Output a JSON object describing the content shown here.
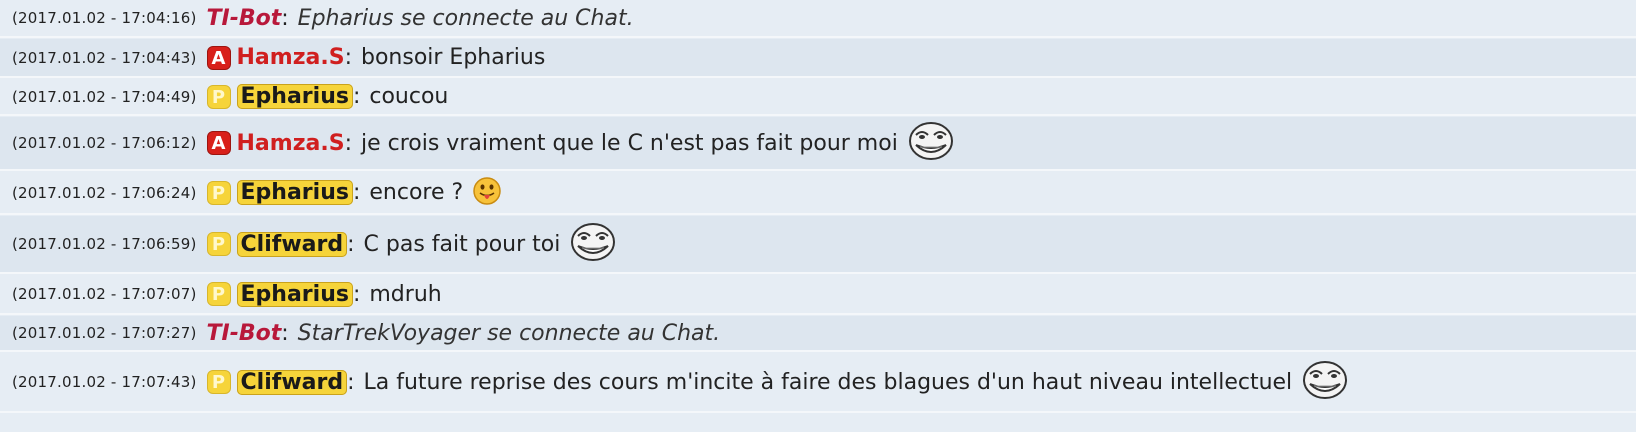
{
  "messages": [
    {
      "timestamp": "(2017.01.02 - 17:04:16)",
      "role": "",
      "user": "TI-Bot",
      "user_type": "bot",
      "text": "Epharius se connecte au Chat.",
      "emoticon": ""
    },
    {
      "timestamp": "(2017.01.02 - 17:04:43)",
      "role": "A",
      "user": "Hamza.S",
      "user_type": "admin",
      "text": "bonsoir Epharius",
      "emoticon": ""
    },
    {
      "timestamp": "(2017.01.02 - 17:04:49)",
      "role": "P",
      "user": "Epharius",
      "user_type": "plain",
      "text": "coucou",
      "emoticon": ""
    },
    {
      "timestamp": "(2017.01.02 - 17:06:12)",
      "role": "A",
      "user": "Hamza.S",
      "user_type": "admin",
      "text": "je crois vraiment que le C n'est pas fait pour moi",
      "emoticon": "trollface-icon"
    },
    {
      "timestamp": "(2017.01.02 - 17:06:24)",
      "role": "P",
      "user": "Epharius",
      "user_type": "plain",
      "text": "encore ?",
      "emoticon": "tongue-smiley-icon"
    },
    {
      "timestamp": "(2017.01.02 - 17:06:59)",
      "role": "P",
      "user": "Clifward",
      "user_type": "plain",
      "text": "C pas fait pour toi",
      "emoticon": "trollface-icon"
    },
    {
      "timestamp": "(2017.01.02 - 17:07:07)",
      "role": "P",
      "user": "Epharius",
      "user_type": "plain",
      "text": "mdruh",
      "emoticon": ""
    },
    {
      "timestamp": "(2017.01.02 - 17:07:27)",
      "role": "",
      "user": "TI-Bot",
      "user_type": "bot",
      "text": "StarTrekVoyager se connecte au Chat.",
      "emoticon": ""
    },
    {
      "timestamp": "(2017.01.02 - 17:07:43)",
      "role": "P",
      "user": "Clifward",
      "user_type": "plain",
      "text": "La future reprise des cours m'incite à faire des blagues d'un haut niveau intellectuel",
      "emoticon": "trollface-icon"
    }
  ],
  "colors": {
    "background": "#e6edf4",
    "row_alt": "#dde6ef",
    "admin": "#d01f1f",
    "bot": "#b8183a",
    "plain_badge": "#f6d43a"
  }
}
